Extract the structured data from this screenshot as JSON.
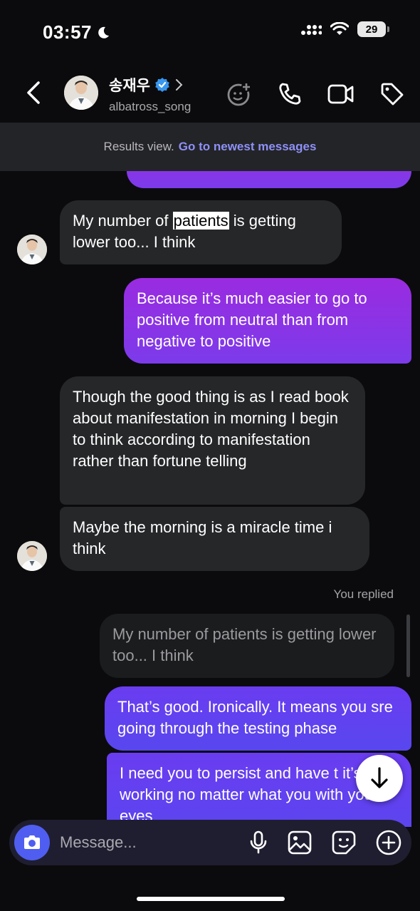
{
  "status_bar": {
    "time": "03:57",
    "battery": "29"
  },
  "header": {
    "name": "송재우",
    "username": "albatross_song",
    "icons": [
      "back-icon",
      "verified-icon",
      "chevron-right-icon",
      "effects-icon",
      "phone-icon",
      "video-icon",
      "tag-icon"
    ]
  },
  "banner": {
    "text": "Results view.",
    "link": "Go to newest messages"
  },
  "messages": [
    {
      "type": "incoming",
      "before": "My number of ",
      "highlight": "patients",
      "after": " is getting lower too... I think"
    },
    {
      "type": "outgoing",
      "text": "Because it’s much easier to go to positive from neutral than from negative to positive"
    },
    {
      "type": "incoming",
      "text": "Though the good thing is as I read book about manifestation in morning I begin to think according to manifestation rather than fortune telling"
    },
    {
      "type": "incoming",
      "text": "Maybe the morning is a miracle time i think"
    },
    {
      "type": "meta",
      "text": "You replied"
    },
    {
      "type": "reply_quote",
      "text": "My number of patients is getting lower too... I think"
    },
    {
      "type": "outgoing",
      "text": "That’s good. Ironically. It means you sre going through the testing phase"
    },
    {
      "type": "outgoing",
      "text": "I need you to persist and have t it’s working no matter what you with your eyes"
    }
  ],
  "composer": {
    "placeholder": "Message...",
    "icons": [
      "camera-icon",
      "microphone-icon",
      "gallery-icon",
      "sticker-icon",
      "plus-icon"
    ]
  },
  "colors": {
    "outgoing_purple": "#9a2be0",
    "outgoing_blue": "#5847ef",
    "incoming": "#262729",
    "link": "#8e90f7",
    "camera_button": "#4f5ef0"
  }
}
